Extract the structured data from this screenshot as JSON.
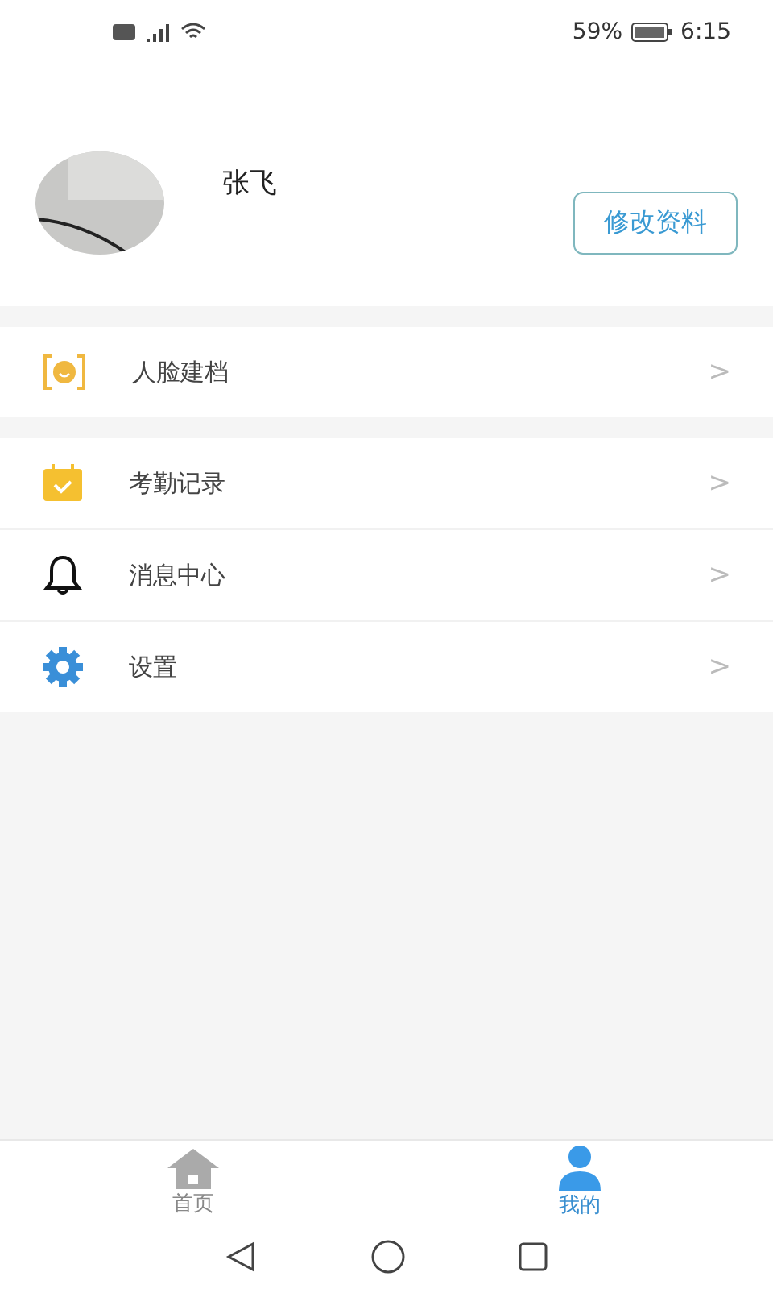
{
  "status_bar": {
    "battery": "59%",
    "time": "6:15"
  },
  "profile": {
    "name": "张飞",
    "edit_button": "修改资料"
  },
  "menu_groups": [
    {
      "items": [
        {
          "kind": "face",
          "label": "人脸建档",
          "chevron": ">"
        }
      ]
    },
    {
      "items": [
        {
          "kind": "calendar",
          "label": "考勤记录",
          "chevron": ">"
        },
        {
          "kind": "bell",
          "label": "消息中心",
          "chevron": ">"
        },
        {
          "kind": "gear",
          "label": "设置",
          "chevron": ">"
        }
      ]
    }
  ],
  "tabs": [
    {
      "kind": "home",
      "label": "首页",
      "selected": false
    },
    {
      "kind": "person",
      "label": "我的",
      "selected": true
    }
  ]
}
